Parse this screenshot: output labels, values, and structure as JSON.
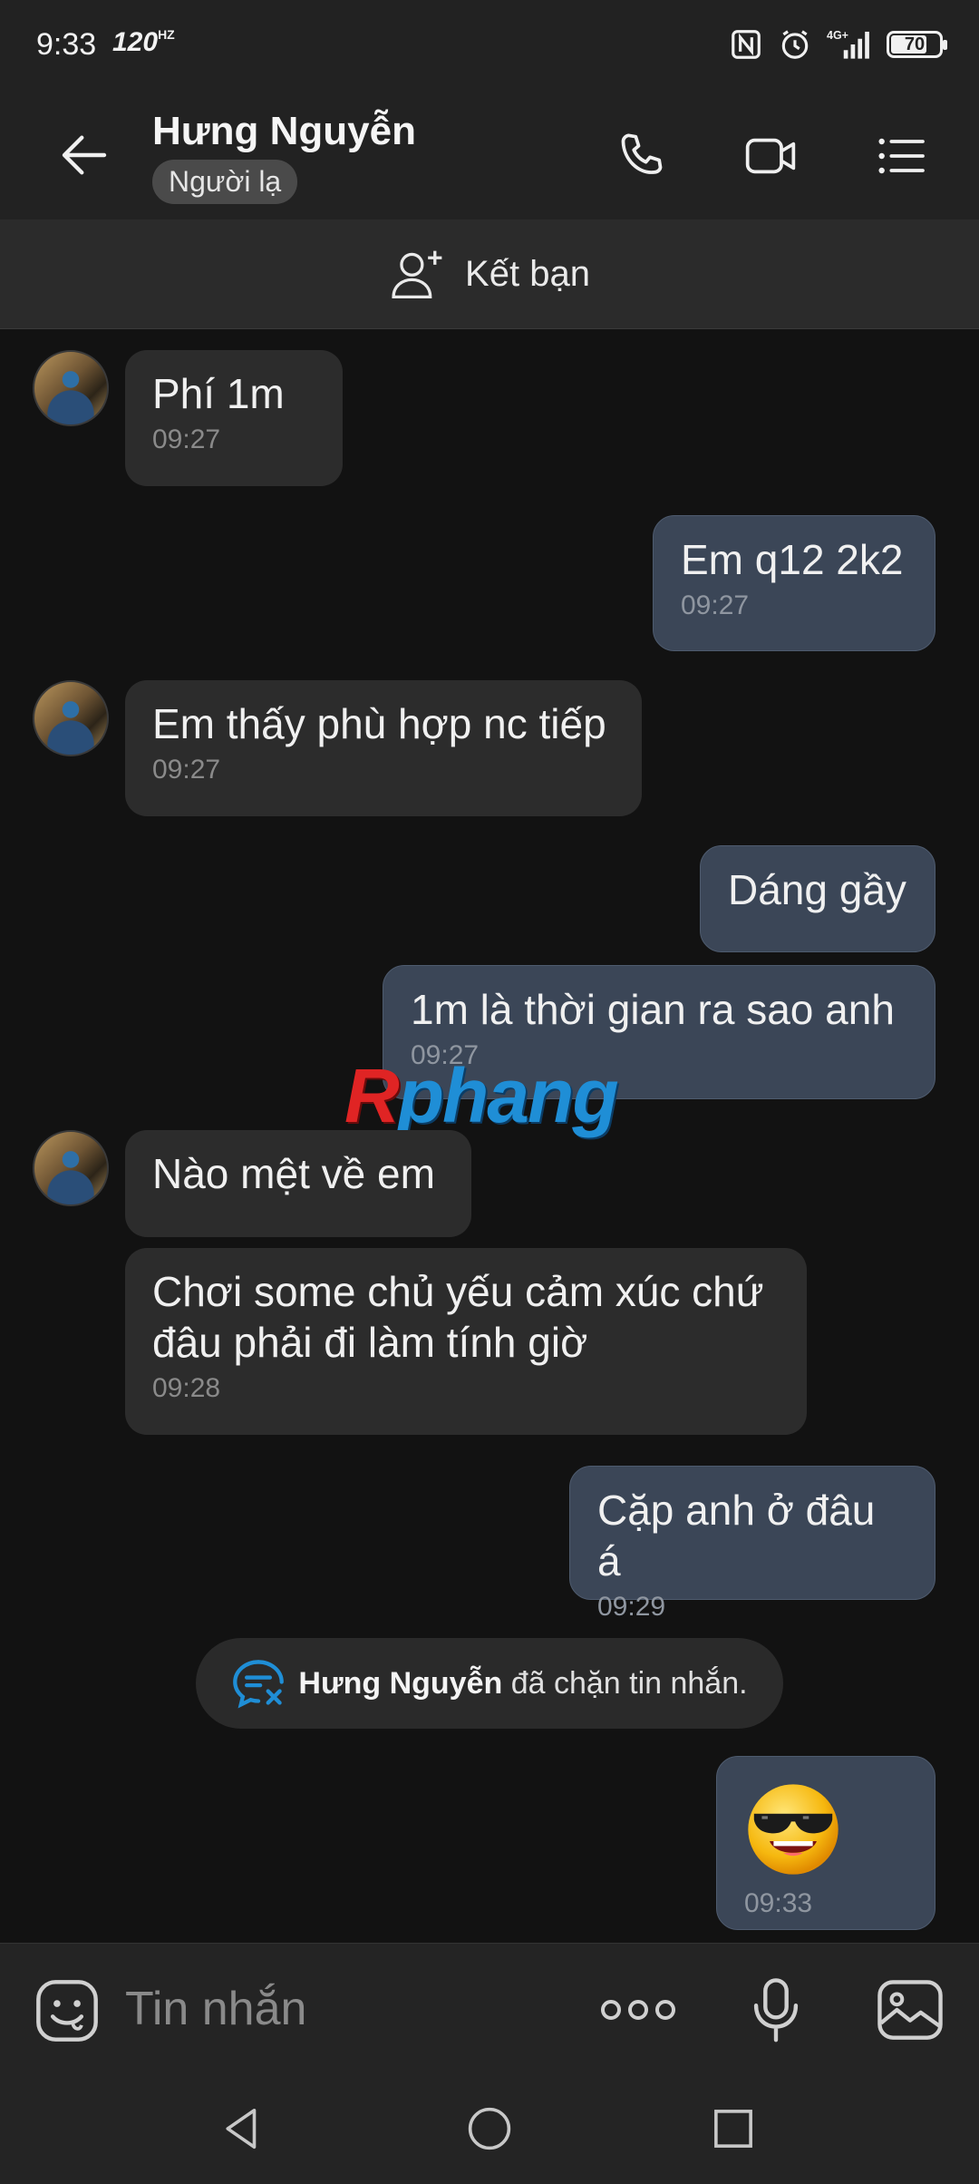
{
  "status_bar": {
    "time": "9:33",
    "refresh_rate": "120",
    "refresh_unit": "HZ",
    "battery": "70",
    "network": "4G+"
  },
  "header": {
    "contact_name": "Hưng Nguyễn",
    "stranger_label": "Người lạ"
  },
  "add_friend": {
    "label": "Kết bạn"
  },
  "messages": [
    {
      "side": "in",
      "text": "Phí 1m",
      "time": "09:27"
    },
    {
      "side": "out",
      "text": "Em q12 2k2",
      "time": "09:27"
    },
    {
      "side": "in",
      "text": "Em thấy phù hợp nc tiếp",
      "time": "09:27"
    },
    {
      "side": "out",
      "text": "Dáng gầy",
      "time": ""
    },
    {
      "side": "out",
      "text": "1m là thời gian ra sao anh",
      "time": "09:27"
    },
    {
      "side": "in",
      "text": "Nào mệt về em",
      "time": ""
    },
    {
      "side": "in",
      "text": "Chơi some chủ yếu cảm xúc chứ\nđâu phải đi làm tính giờ",
      "time": "09:28"
    },
    {
      "side": "out",
      "text": "Cặp anh ở đâu á",
      "time": "09:29"
    },
    {
      "side": "out",
      "text": "",
      "sticker": "sunglasses-emoji",
      "time": "09:33"
    }
  ],
  "system_notice": {
    "name": "Hưng Nguyễn",
    "text": " đã chặn tin nhắn."
  },
  "watermark": {
    "red": "R",
    "blue": "phang"
  },
  "input_bar": {
    "placeholder": "Tin nhắn"
  },
  "colors": {
    "background": "#121212",
    "incoming_bubble": "#2c2c2c",
    "outgoing_bubble": "#3b4657",
    "accent_blue": "#1f8ed6"
  }
}
